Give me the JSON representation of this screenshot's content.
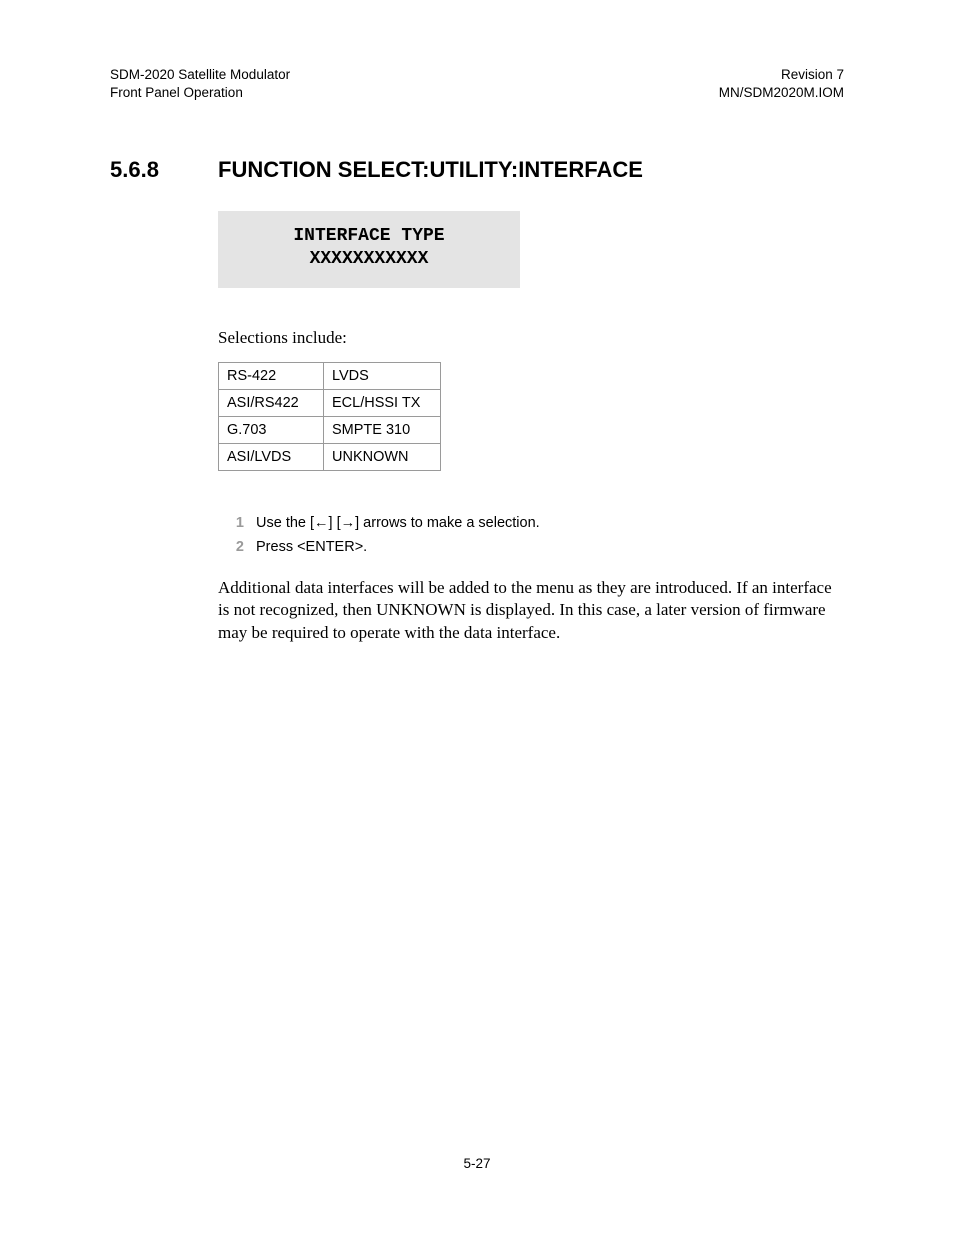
{
  "header": {
    "left_line1": "SDM-2020 Satellite Modulator",
    "left_line2": "Front Panel Operation",
    "right_line1": "Revision 7",
    "right_line2": "MN/SDM2020M.IOM"
  },
  "section": {
    "number": "5.6.8",
    "title": "FUNCTION SELECT:UTILITY:INTERFACE"
  },
  "lcd": {
    "line1": "INTERFACE TYPE",
    "line2": "XXXXXXXXXXX"
  },
  "intro": "Selections include:",
  "options": {
    "rows": [
      {
        "c1": "RS-422",
        "c2": "LVDS"
      },
      {
        "c1": "ASI/RS422",
        "c2": "ECL/HSSI TX"
      },
      {
        "c1": "G.703",
        "c2": "SMPTE 310"
      },
      {
        "c1": "ASI/LVDS",
        "c2": "UNKNOWN"
      }
    ]
  },
  "steps": [
    {
      "num": "1",
      "text_pre": "Use the [",
      "arrow1": "←",
      "mid": "] [",
      "arrow2": "→",
      "text_post": "] arrows to make a selection."
    },
    {
      "num": "2",
      "text": "Press <ENTER>."
    }
  ],
  "paragraph": "Additional data interfaces will be added to the menu as they are introduced. If an interface is not recognized, then UNKNOWN is displayed. In this case, a later version of firmware may be required to operate with the data interface.",
  "page_number": "5-27"
}
